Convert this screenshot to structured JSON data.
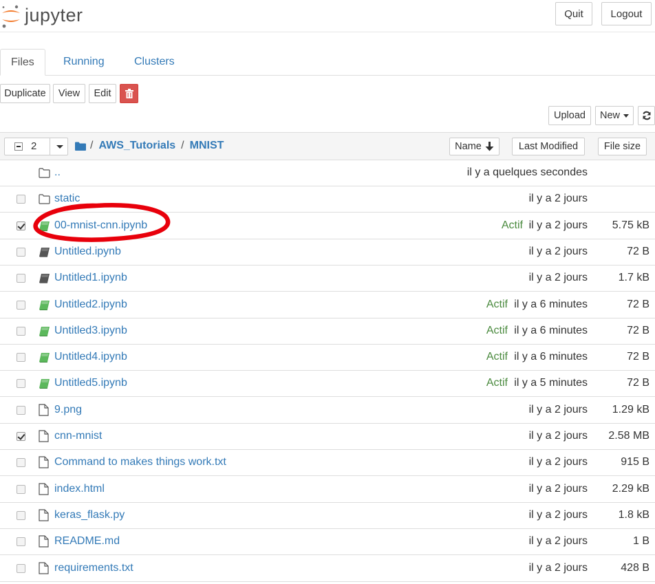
{
  "header": {
    "logo_text": "jupyter",
    "quit_label": "Quit",
    "logout_label": "Logout"
  },
  "tabs": [
    {
      "label": "Files",
      "active": true
    },
    {
      "label": "Running",
      "active": false
    },
    {
      "label": "Clusters",
      "active": false
    }
  ],
  "toolbar": {
    "duplicate_label": "Duplicate",
    "view_label": "View",
    "edit_label": "Edit",
    "upload_label": "Upload",
    "new_label": "New"
  },
  "list_header": {
    "selected_count": "2",
    "breadcrumb": [
      "AWS_Tutorials",
      "MNIST"
    ],
    "separator": "/",
    "sort_name_label": "Name",
    "sort_modified_label": "Last Modified",
    "sort_size_label": "File size"
  },
  "rows": [
    {
      "name": "..",
      "icon": "folder-icon",
      "checkbox": false,
      "running": "",
      "modified": "il y a quelques secondes",
      "size": ""
    },
    {
      "name": "static",
      "icon": "folder-icon",
      "checkbox": true,
      "checked": false,
      "running": "",
      "modified": "il y a 2 jours",
      "size": ""
    },
    {
      "name": "00-mnist-cnn.ipynb",
      "icon": "notebook-green-icon",
      "checkbox": true,
      "checked": true,
      "running": "Actif",
      "modified": "il y a 2 jours",
      "size": "5.75 kB"
    },
    {
      "name": "Untitled.ipynb",
      "icon": "notebook-icon",
      "checkbox": true,
      "checked": false,
      "running": "",
      "modified": "il y a 2 jours",
      "size": "72 B"
    },
    {
      "name": "Untitled1.ipynb",
      "icon": "notebook-icon",
      "checkbox": true,
      "checked": false,
      "running": "",
      "modified": "il y a 2 jours",
      "size": "1.7 kB"
    },
    {
      "name": "Untitled2.ipynb",
      "icon": "notebook-green-icon",
      "checkbox": true,
      "checked": false,
      "running": "Actif",
      "modified": "il y a 6 minutes",
      "size": "72 B"
    },
    {
      "name": "Untitled3.ipynb",
      "icon": "notebook-green-icon",
      "checkbox": true,
      "checked": false,
      "running": "Actif",
      "modified": "il y a 6 minutes",
      "size": "72 B"
    },
    {
      "name": "Untitled4.ipynb",
      "icon": "notebook-green-icon",
      "checkbox": true,
      "checked": false,
      "running": "Actif",
      "modified": "il y a 6 minutes",
      "size": "72 B"
    },
    {
      "name": "Untitled5.ipynb",
      "icon": "notebook-green-icon",
      "checkbox": true,
      "checked": false,
      "running": "Actif",
      "modified": "il y a 5 minutes",
      "size": "72 B"
    },
    {
      "name": "9.png",
      "icon": "file-icon",
      "checkbox": true,
      "checked": false,
      "running": "",
      "modified": "il y a 2 jours",
      "size": "1.29 kB"
    },
    {
      "name": "cnn-mnist",
      "icon": "file-icon",
      "checkbox": true,
      "checked": true,
      "running": "",
      "modified": "il y a 2 jours",
      "size": "2.58 MB"
    },
    {
      "name": "Command to makes things work.txt",
      "icon": "file-icon",
      "checkbox": true,
      "checked": false,
      "running": "",
      "modified": "il y a 2 jours",
      "size": "915 B"
    },
    {
      "name": "index.html",
      "icon": "file-icon",
      "checkbox": true,
      "checked": false,
      "running": "",
      "modified": "il y a 2 jours",
      "size": "2.29 kB"
    },
    {
      "name": "keras_flask.py",
      "icon": "file-icon",
      "checkbox": true,
      "checked": false,
      "running": "",
      "modified": "il y a 2 jours",
      "size": "1.8 kB"
    },
    {
      "name": "README.md",
      "icon": "file-icon",
      "checkbox": true,
      "checked": false,
      "running": "",
      "modified": "il y a 2 jours",
      "size": "1 B"
    },
    {
      "name": "requirements.txt",
      "icon": "file-icon",
      "checkbox": true,
      "checked": false,
      "running": "",
      "modified": "il y a 2 jours",
      "size": "428 B"
    }
  ],
  "colors": {
    "link": "#337ab7",
    "running": "#4a8a3e",
    "delete": "#d9534f",
    "logo_orange": "#f37726",
    "annotation": "#e8000b"
  }
}
